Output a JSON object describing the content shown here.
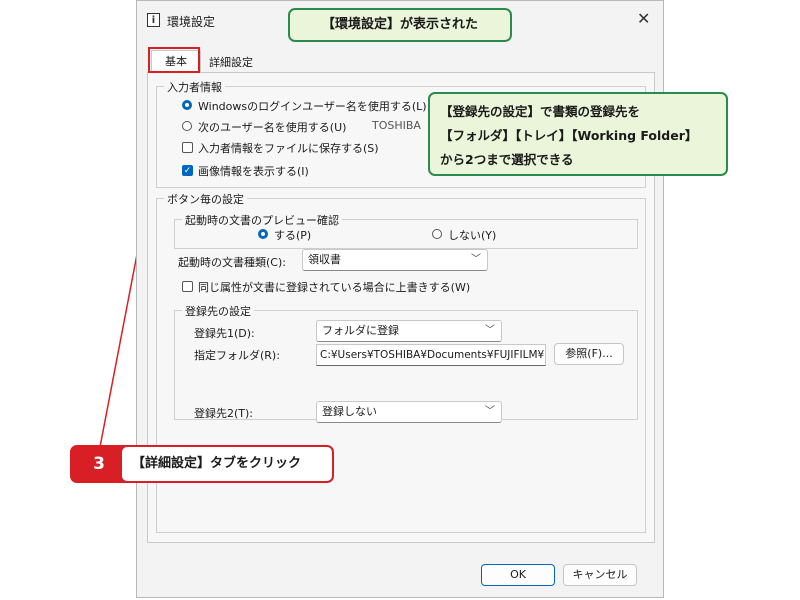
{
  "window": {
    "title": "環境設定",
    "close_glyph": "✕",
    "icon_glyph": "i"
  },
  "tabs": [
    "基本",
    "詳細設定"
  ],
  "user_info": {
    "group_label": "入力者情報",
    "radio_windows": "Windowsのログインユーザー名を使用する(L)",
    "radio_next": "次のユーザー名を使用する(U)",
    "username_value": "TOSHIBA",
    "check_save": "入力者情報をファイルに保存する(S)",
    "check_image": "画像情報を表示する(I)"
  },
  "button_settings": {
    "group_label": "ボタン毎の設定",
    "preview_group_label": "起動時の文書のプレビュー確認",
    "radio_yes": "する(P)",
    "radio_no": "しない(Y)",
    "doc_type_label": "起動時の文書種類(C):",
    "doc_type_value": "領収書",
    "overwrite_label": "同じ属性が文書に登録されている場合に上書きする(W)"
  },
  "registration": {
    "group_label": "登録先の設定",
    "dest1_label": "登録先1(D):",
    "dest1_value": "フォルダに登録",
    "folder_label": "指定フォルダ(R):",
    "folder_value": "C:¥Users¥TOSHIBA¥Documents¥FUJIFILM¥",
    "browse_label": "参照(F)...",
    "dest2_label": "登録先2(T):",
    "dest2_value": "登録しない"
  },
  "footer": {
    "ok": "OK",
    "cancel": "キャンセル"
  },
  "callouts": {
    "top": "【環境設定】が表示された",
    "right_line1": "【登録先の設定】で書類の登録先を",
    "right_line2": "【フォルダ】【トレイ】【Working Folder】",
    "right_line3": "から2つまで選択できる",
    "step_number": "3",
    "step_text": "【詳細設定】タブをクリック"
  },
  "colors": {
    "accent": "#0067c0",
    "callout_green": "#2d8a4e",
    "callout_green_bg": "#eaf5d9",
    "callout_red": "#d81f26"
  },
  "icons": {
    "close": "close-icon",
    "chevron": "chevron-down-icon",
    "app": "app-info-icon"
  }
}
